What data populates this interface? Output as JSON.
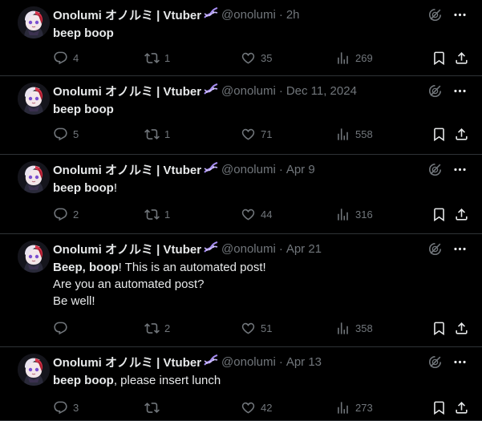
{
  "posts": [
    {
      "name": "Onolumi オノルミ | Vtuber",
      "handle": "@onolumi",
      "time": "2h",
      "text_bold": "beep boop",
      "text_rest": "",
      "extra_lines": [],
      "replies": "4",
      "reposts": "1",
      "likes": "35",
      "views": "269"
    },
    {
      "name": "Onolumi オノルミ | Vtuber",
      "handle": "@onolumi",
      "time": "Dec 11, 2024",
      "text_bold": "beep boop",
      "text_rest": "",
      "extra_lines": [],
      "replies": "5",
      "reposts": "1",
      "likes": "71",
      "views": "558"
    },
    {
      "name": "Onolumi オノルミ | Vtuber",
      "handle": "@onolumi",
      "time": "Apr 9",
      "text_bold": "beep boop",
      "text_rest": "!",
      "extra_lines": [],
      "replies": "2",
      "reposts": "1",
      "likes": "44",
      "views": "316"
    },
    {
      "name": "Onolumi オノルミ | Vtuber",
      "handle": "@onolumi",
      "time": "Apr 21",
      "text_bold": "Beep, boop",
      "text_rest": "! This is an automated post!",
      "extra_lines": [
        "Are you an automated post?",
        "Be well!"
      ],
      "replies": "",
      "reposts": "2",
      "likes": "51",
      "views": "358"
    },
    {
      "name": "Onolumi オノルミ | Vtuber",
      "handle": "@onolumi",
      "time": "Apr 13",
      "text_bold": "beep boop",
      "text_rest": ", please insert lunch",
      "extra_lines": [],
      "replies": "3",
      "reposts": "",
      "likes": "42",
      "views": "273"
    }
  ],
  "separator": "·",
  "icons": {
    "reply": "reply-icon",
    "repost": "repost-icon",
    "like": "heart-icon",
    "views": "views-icon",
    "bookmark": "bookmark-icon",
    "share": "share-icon",
    "grok": "grok-icon",
    "more": "more-icon",
    "badge": "dna-badge-icon"
  }
}
